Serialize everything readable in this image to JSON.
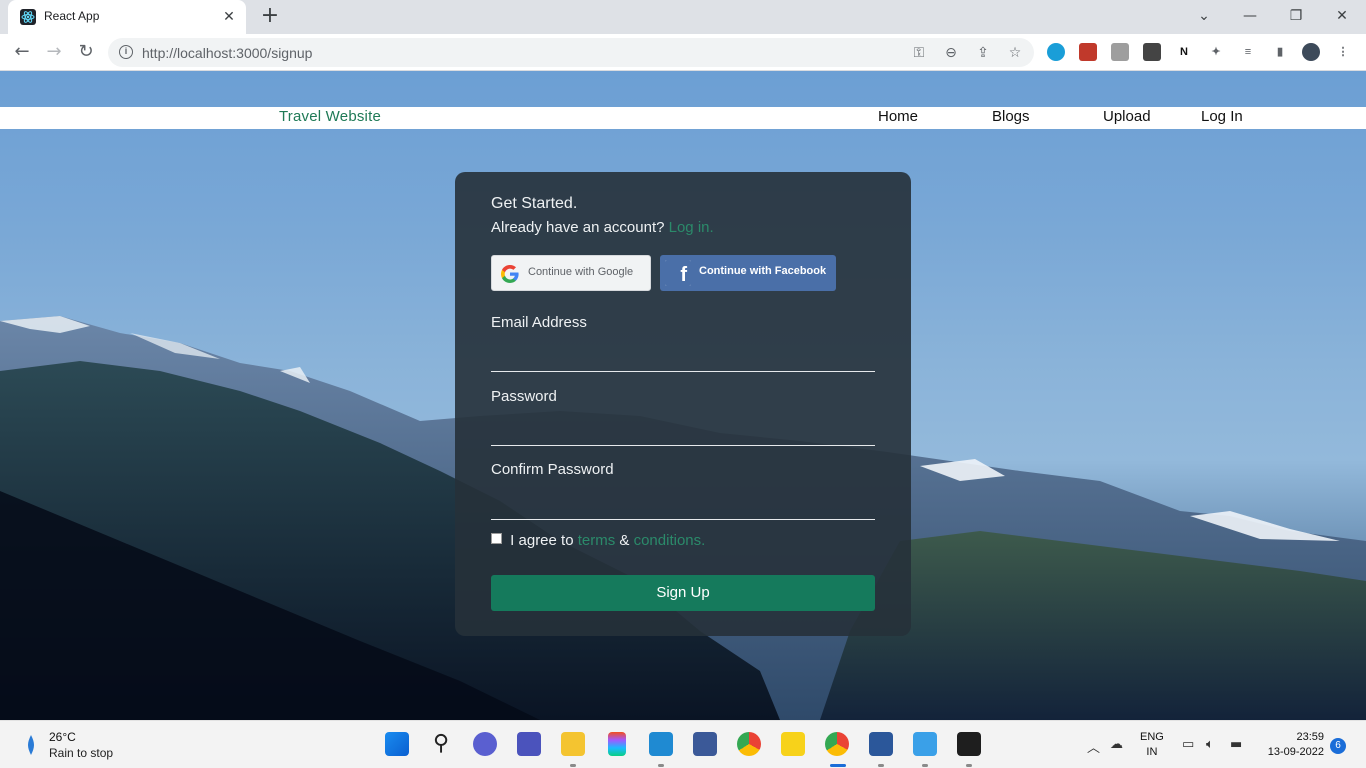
{
  "browser": {
    "tab_title": "React App",
    "url": "http://localhost:3000/signup"
  },
  "navbar": {
    "brand": "Travel Website",
    "links": [
      "Home",
      "Blogs",
      "Upload",
      "Log In"
    ]
  },
  "signup_card": {
    "heading": "Get Started.",
    "subheading": "Already have an account?",
    "login_link": "Log in.",
    "google_button": "Continue with Google",
    "facebook_button": "Continue with Facebook",
    "email_label": "Email Address",
    "password_label": "Password",
    "confirm_password_label": "Confirm Password",
    "email_value": "",
    "password_value": "",
    "confirm_password_value": "",
    "agree_prefix": "I agree to",
    "terms_link": "terms",
    "ampersand": "&",
    "conditions_link": "conditions.",
    "agree_checked": false,
    "submit_label": "Sign Up"
  },
  "taskbar": {
    "temperature": "26°C",
    "weather_desc": "Rain to stop",
    "lang_line1": "ENG",
    "lang_line2": "IN",
    "time": "23:59",
    "date": "13-09-2022",
    "notification_count": "6",
    "apps": [
      "start-icon",
      "search-icon",
      "meet-icon",
      "teams-icon",
      "file-explorer-icon",
      "figma-icon",
      "vscode-icon",
      "devc-icon",
      "chrome-icon",
      "sticky-notes-icon",
      "chrome-active-icon",
      "word-icon",
      "notepad-icon",
      "terminal-icon"
    ]
  },
  "colors": {
    "accent_green": "#157a5c",
    "link_green": "#2b8a6a",
    "facebook_blue": "#4a6fa8"
  }
}
